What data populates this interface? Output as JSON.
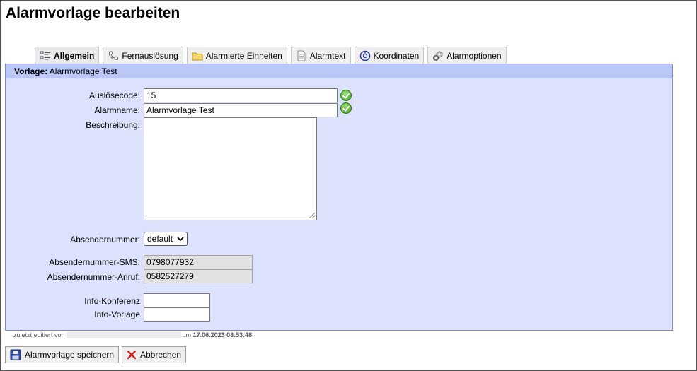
{
  "page": {
    "title": "Alarmvorlage bearbeiten"
  },
  "tabs": [
    {
      "label": "Allgemein",
      "icon": "form-list-icon",
      "active": true
    },
    {
      "label": "Fernauslösung",
      "icon": "phone-icon",
      "active": false
    },
    {
      "label": "Alarmierte Einheiten",
      "icon": "folder-icon",
      "active": false
    },
    {
      "label": "Alarmtext",
      "icon": "document-icon",
      "active": false
    },
    {
      "label": "Koordinaten",
      "icon": "compass-icon",
      "active": false
    },
    {
      "label": "Alarmoptionen",
      "icon": "gears-icon",
      "active": false
    }
  ],
  "panel": {
    "header_label": "Vorlage:",
    "header_value": "Alarmvorlage Test"
  },
  "form": {
    "ausloesecode_label": "Auslösecode:",
    "ausloesecode_value": "15",
    "alarmname_label": "Alarmname:",
    "alarmname_value": "Alarmvorlage Test",
    "beschreibung_label": "Beschreibung:",
    "beschreibung_value": "",
    "absendernummer_label": "Absendernummer:",
    "absendernummer_value": "default",
    "sms_label": "Absendernummer-SMS:",
    "sms_value": "0798077932",
    "anruf_label": "Absendernummer-Anruf:",
    "anruf_value": "0582527279",
    "info_konferenz_label": "Info-Konferenz",
    "info_konferenz_value": "",
    "info_vorlage_label": "Info-Vorlage",
    "info_vorlage_value": ""
  },
  "footer": {
    "edited_prefix": "zuletzt editiert von",
    "edited_mid": "um",
    "edited_date": "17.06.2023 08:53:48"
  },
  "buttons": {
    "save_label": "Alarmvorlage speichern",
    "cancel_label": "Abbrechen"
  },
  "colors": {
    "panel_bg": "#dce2fb",
    "panel_header_bg": "#bac7f7",
    "panel_border": "#7d8bd6",
    "ok_green": "#3e9a1f",
    "cancel_red": "#d22222"
  }
}
